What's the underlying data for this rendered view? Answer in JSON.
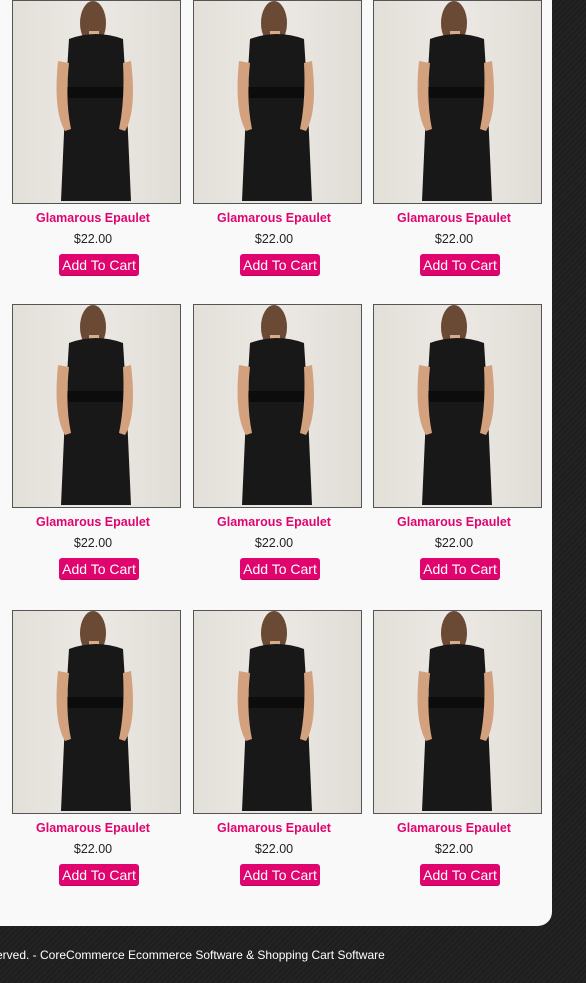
{
  "products": [
    {
      "name": "Glamarous Epaulet",
      "price": "$22.00",
      "button": "Add To Cart"
    },
    {
      "name": "Glamarous Epaulet",
      "price": "$22.00",
      "button": "Add To Cart"
    },
    {
      "name": "Glamarous Epaulet",
      "price": "$22.00",
      "button": "Add To Cart"
    },
    {
      "name": "Glamarous Epaulet",
      "price": "$22.00",
      "button": "Add To Cart"
    },
    {
      "name": "Glamarous Epaulet",
      "price": "$22.00",
      "button": "Add To Cart"
    },
    {
      "name": "Glamarous Epaulet",
      "price": "$22.00",
      "button": "Add To Cart"
    },
    {
      "name": "Glamarous Epaulet",
      "price": "$22.00",
      "button": "Add To Cart"
    },
    {
      "name": "Glamarous Epaulet",
      "price": "$22.00",
      "button": "Add To Cart"
    },
    {
      "name": "Glamarous Epaulet",
      "price": "$22.00",
      "button": "Add To Cart"
    }
  ],
  "footer": {
    "text": "erved. - CoreCommerce Ecommerce Software & Shopping Cart Software"
  },
  "colors": {
    "accent": "#e0046f",
    "panel": "#f9f9f9",
    "background": "#1c1c1c"
  }
}
